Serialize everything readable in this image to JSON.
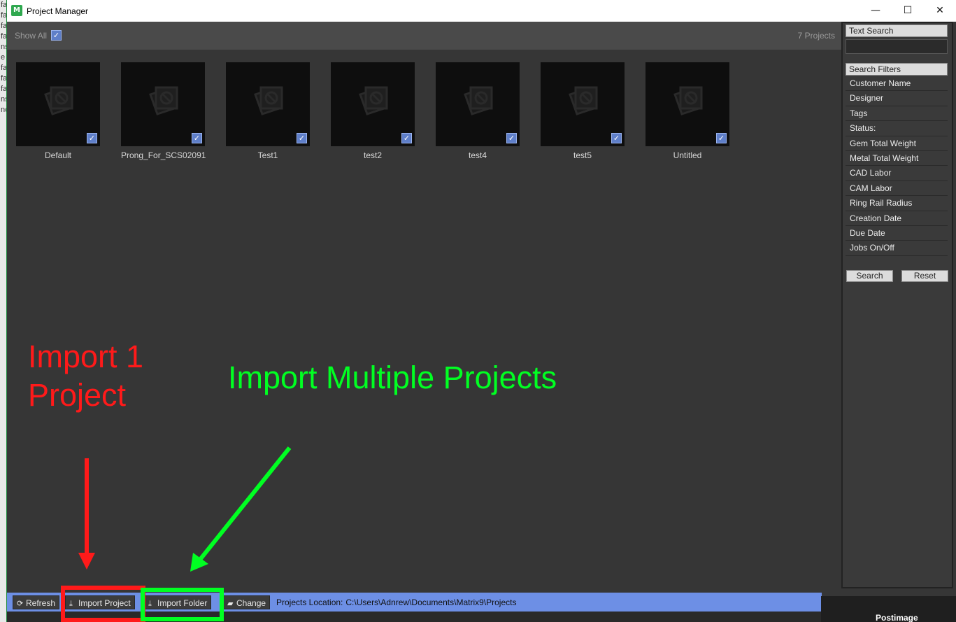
{
  "window": {
    "title": "Project Manager",
    "icon": "app-icon"
  },
  "window_controls": {
    "minimize": "—",
    "maximize": "☐",
    "close": "✕"
  },
  "background_strip": [
    "fa",
    "fa",
    "fa",
    "fa",
    "ns",
    "e",
    "fa",
    "fa",
    "fa",
    "ns",
    "nc"
  ],
  "toolbar": {
    "show_all_label": "Show All",
    "show_all_checked": true,
    "project_count": "7  Projects"
  },
  "projects": [
    {
      "name": "Default",
      "checked": true
    },
    {
      "name": "Prong_For_SCS02091",
      "checked": true
    },
    {
      "name": "Test1",
      "checked": true
    },
    {
      "name": "test2",
      "checked": true
    },
    {
      "name": "test4",
      "checked": true
    },
    {
      "name": "test5",
      "checked": true
    },
    {
      "name": "Untitled",
      "checked": true
    }
  ],
  "sidebar": {
    "text_search_label": "Text Search",
    "text_search_value": "",
    "filters_label": "Search Filters",
    "filters": [
      "Customer Name",
      "Designer",
      "Tags",
      "Status:",
      "Gem Total Weight",
      "Metal Total Weight",
      "CAD Labor",
      "CAM Labor",
      "Ring Rail Radius",
      "Creation Date",
      "Due Date",
      "Jobs On/Off"
    ],
    "search_button": "Search",
    "reset_button": "Reset"
  },
  "bottombar": {
    "refresh": "Refresh",
    "import_project": "Import Project",
    "import_folder": "Import Folder",
    "change": "Change",
    "location_label": "Projects Location:",
    "location_path": "C:\\Users\\Adnrew\\Documents\\Matrix9\\Projects"
  },
  "annotations": {
    "red_text": "Import 1\nProject",
    "green_text": "Import Multiple Projects",
    "red_color": "#ff1a1a",
    "green_color": "#00ff22"
  },
  "taskbar_popup": {
    "label": "Postimage"
  },
  "colors": {
    "panel": "#363636",
    "toolbar": "#4a4a4a",
    "accent": "#6d8fe5",
    "check": "#5f7fc9"
  }
}
